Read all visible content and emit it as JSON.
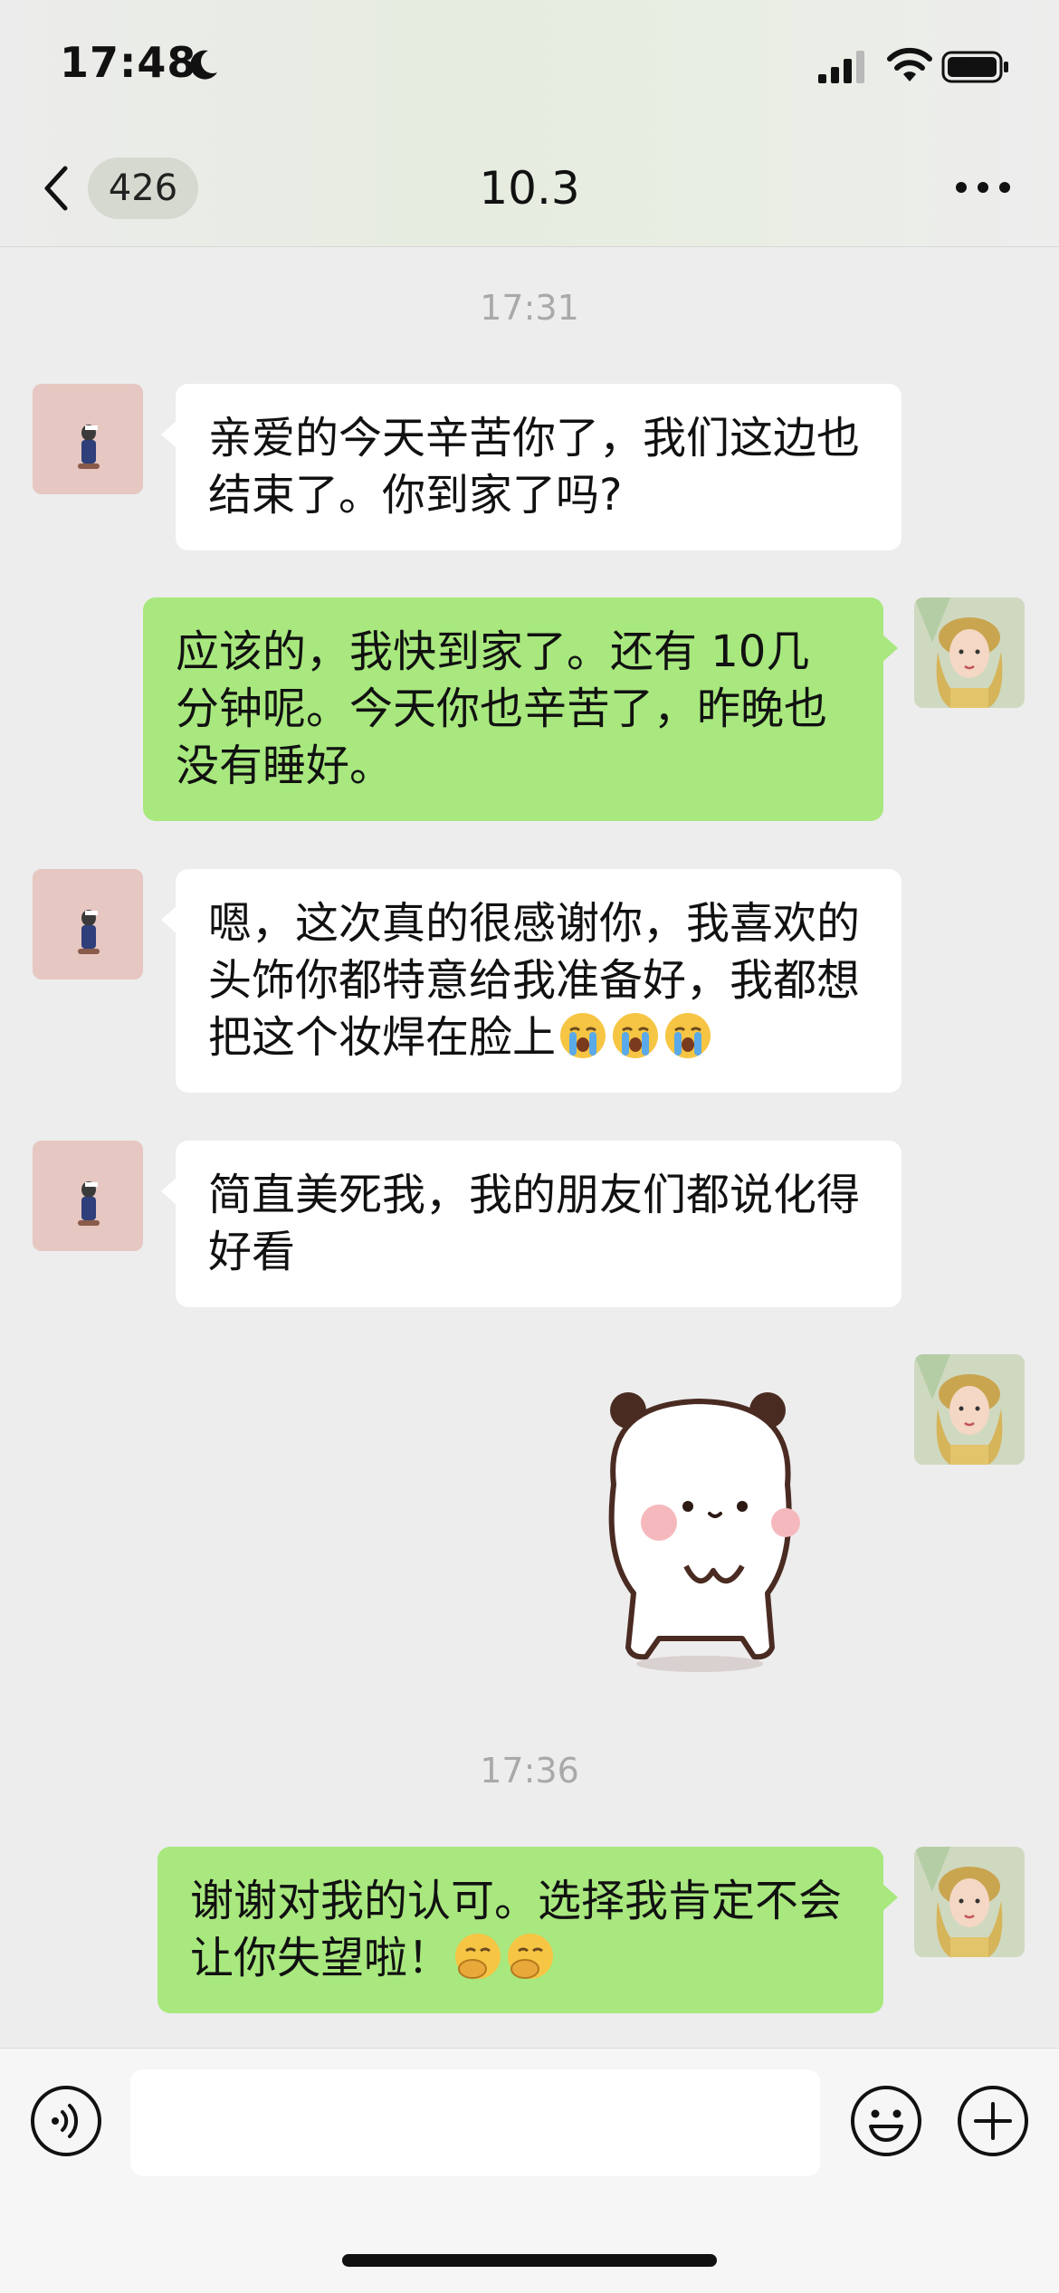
{
  "status_bar": {
    "time": "17:48"
  },
  "nav": {
    "unread_count": "426",
    "title": "10.3"
  },
  "messages": [
    {
      "timestamp": "17:31"
    },
    {
      "side": "left",
      "text": "亲爱的今天辛苦你了，我们这边也结束了。你到家了吗?"
    },
    {
      "side": "right",
      "text": "应该的，我快到家了。还有 10几分钟呢。今天你也辛苦了，昨晚也没有睡好。"
    },
    {
      "side": "left",
      "text": "嗯，这次真的很感谢你，我喜欢的头饰你都特意给我准备好，我都想把这个妆焊在脸上",
      "emojis": [
        "crying-face",
        "crying-face",
        "crying-face"
      ]
    },
    {
      "side": "left",
      "text": "简直美死我，我的朋友们都说化得好看"
    },
    {
      "side": "right",
      "sticker": "panda-sticker"
    },
    {
      "timestamp": "17:36"
    },
    {
      "side": "right",
      "text": "谢谢对我的认可。选择我肯定不会让你失望啦！",
      "emojis": [
        "hand-over-mouth-face",
        "hand-over-mouth-face"
      ]
    }
  ],
  "colors": {
    "bubble_sent": "#a8e87e",
    "bubble_received": "#ffffff",
    "background": "#ededed"
  },
  "icons": {
    "back": "chevron-left-icon",
    "more": "ellipsis-icon",
    "voice": "voice-icon",
    "emoji": "smiley-icon",
    "plus": "plus-icon"
  },
  "input": {
    "value": "",
    "placeholder": ""
  }
}
